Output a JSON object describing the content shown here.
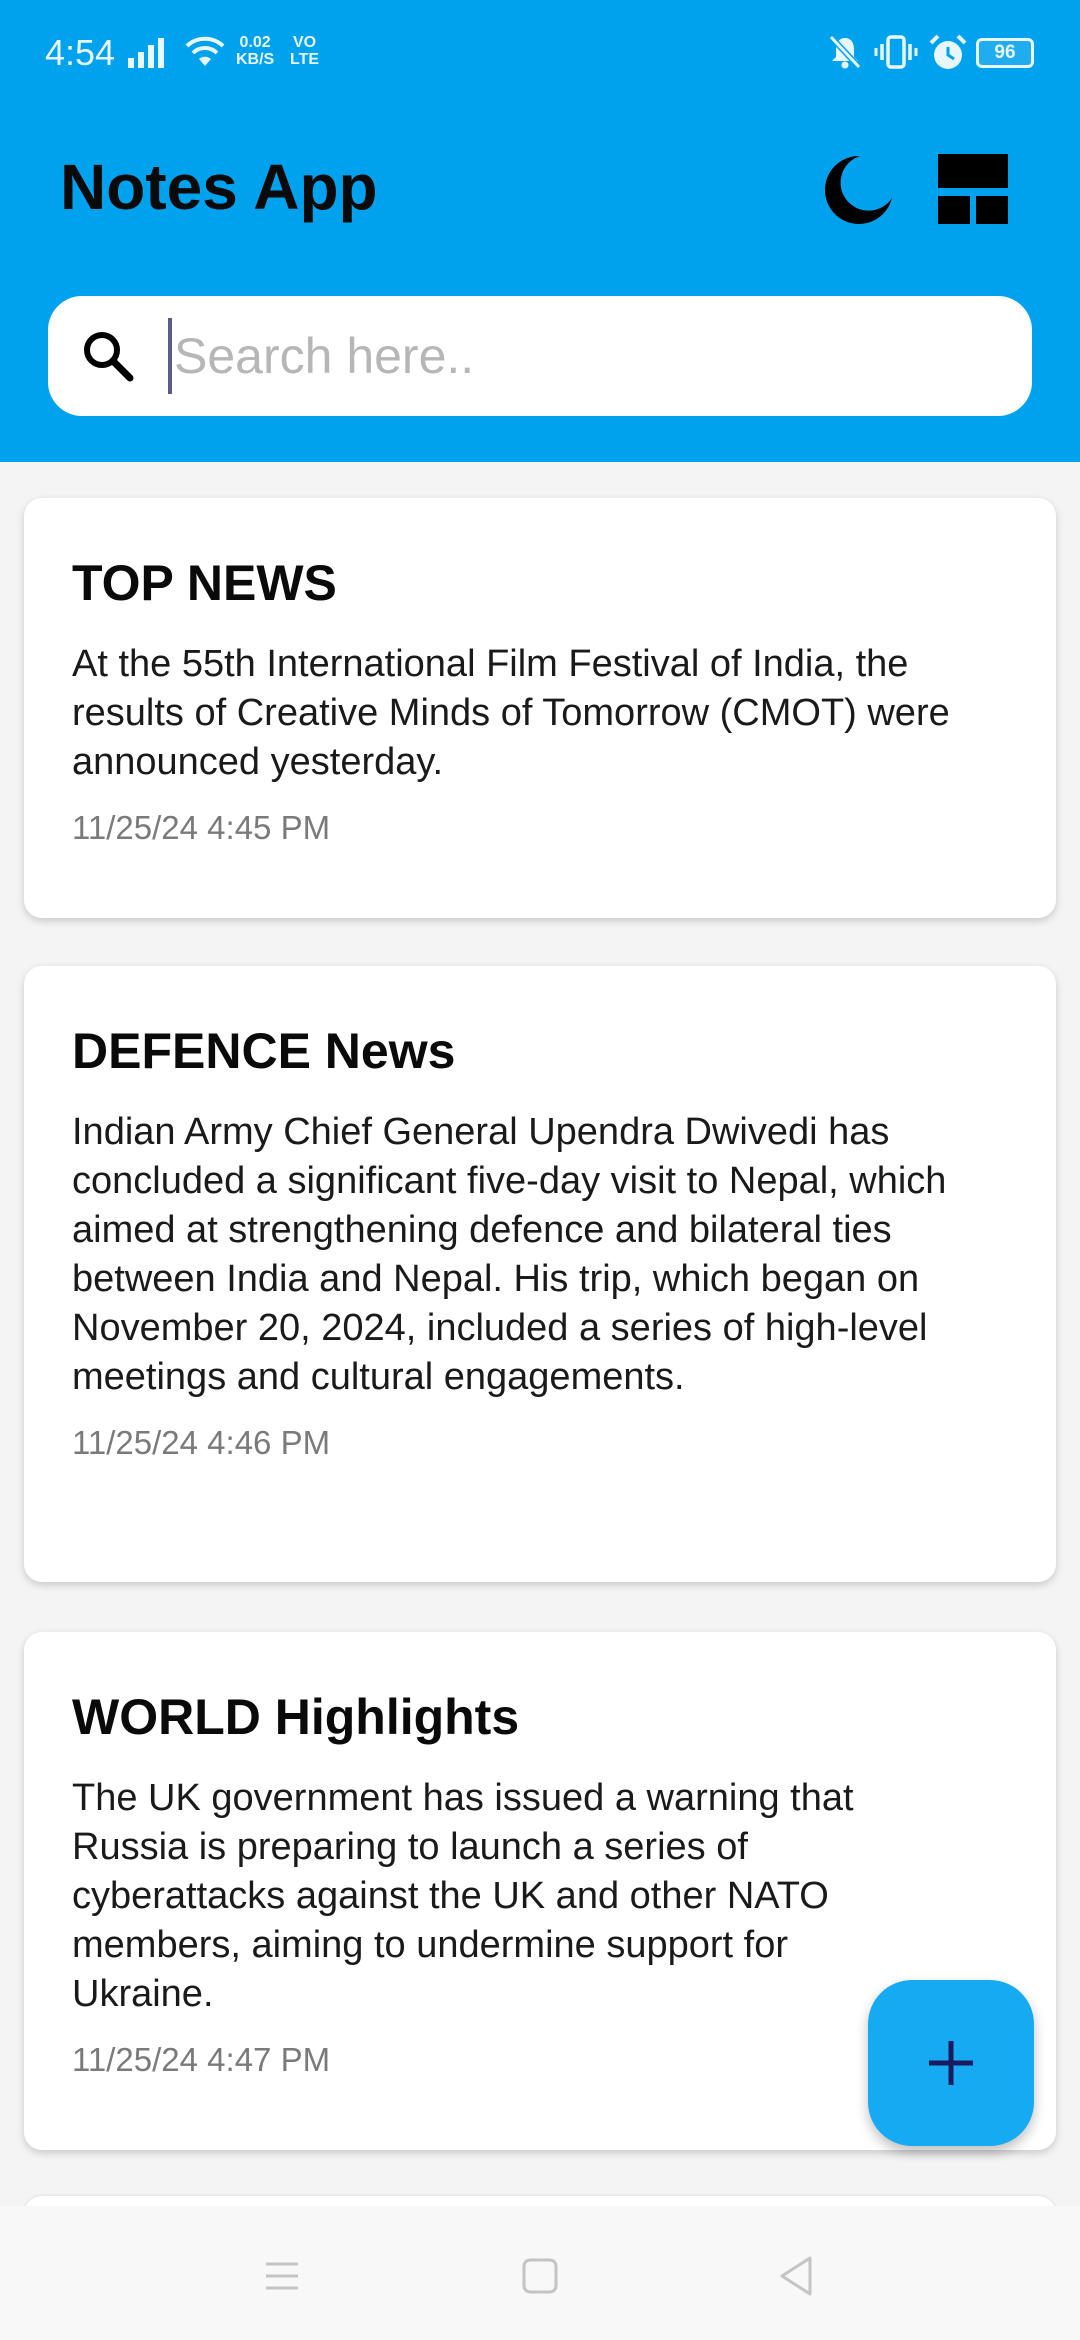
{
  "status_bar": {
    "time": "4:54",
    "net_speed_value": "0.02",
    "net_speed_unit": "KB/S",
    "volte_top": "VO",
    "volte_bottom": "LTE",
    "battery": "96"
  },
  "header": {
    "title": "Notes App",
    "theme_icon": "moon-icon",
    "layout_icon": "grid-view-icon"
  },
  "search": {
    "placeholder": "Search here..",
    "value": ""
  },
  "notes": [
    {
      "title": "TOP NEWS",
      "body": "At the 55th International Film Festival of India, the results of Creative Minds of Tomorrow (CMOT) were announced yesterday.",
      "timestamp": "11/25/24 4:45 PM"
    },
    {
      "title": "DEFENCE News",
      "body": "Indian Army Chief General Upendra Dwivedi has concluded a significant five-day visit to Nepal, which aimed at strengthening defence and bilateral ties between India and Nepal. His trip, which began on November 20, 2024, included a series of high-level meetings and cultural engagements.",
      "timestamp": "11/25/24 4:46 PM"
    },
    {
      "title": "WORLD Highlights",
      "body": "The UK government has issued a warning that Russia is preparing to launch a series of cyberattacks against the UK and other NATO members, aiming to undermine support for Ukraine.",
      "timestamp": "11/25/24 4:47 PM"
    }
  ],
  "fab": {
    "icon": "plus-icon"
  },
  "nav_bar": {
    "icons": [
      "menu-icon",
      "home-icon",
      "back-icon"
    ]
  },
  "colors": {
    "header_bg": "#00a2ee",
    "fab_bg": "#15aaf2",
    "page_bg": "#f4f4f4",
    "card_bg": "#ffffff",
    "timestamp": "#7a7a7a"
  }
}
